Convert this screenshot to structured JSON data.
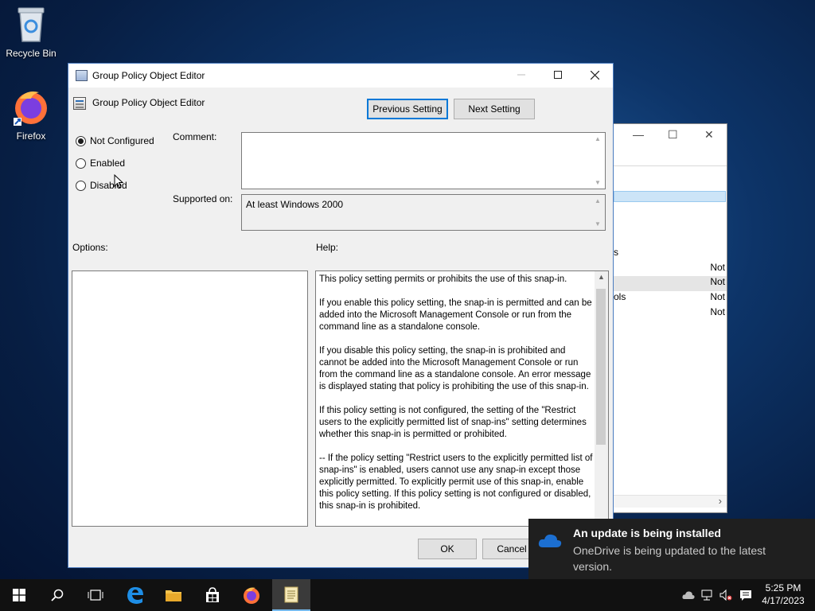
{
  "desktop": {
    "icons": [
      {
        "label": "Recycle Bin"
      },
      {
        "label": "Firefox"
      }
    ]
  },
  "background_window": {
    "title_controls": [
      "—",
      "☐",
      "✕"
    ],
    "row_fragments": [
      {
        "left": "s",
        "right": ""
      },
      {
        "left": "",
        "right": "Not"
      },
      {
        "left": "",
        "right": "Not"
      },
      {
        "left": "ols",
        "right": "Not"
      },
      {
        "left": "",
        "right": "Not"
      }
    ],
    "scroll_right_glyph": "›"
  },
  "dialog": {
    "window_title": "Group Policy Object Editor",
    "header_title": "Group Policy Object Editor",
    "previous_button": "Previous Setting",
    "next_button": "Next Setting",
    "radio_options": [
      {
        "label": "Not Configured",
        "selected": true
      },
      {
        "label": "Enabled",
        "selected": false
      },
      {
        "label": "Disabled",
        "selected": false
      }
    ],
    "comment_label": "Comment:",
    "comment_value": "",
    "supported_on_label": "Supported on:",
    "supported_on_value": "At least Windows 2000",
    "options_label": "Options:",
    "help_label": "Help:",
    "help_paragraphs": [
      "This policy setting permits or prohibits the use of this snap-in.",
      "If you enable this policy setting, the snap-in is permitted and can be added into the Microsoft Management Console or run from the command line as a standalone console.",
      "If you disable this policy setting, the snap-in is prohibited and cannot be added into the Microsoft Management Console or run from the command line as a standalone console. An error message is displayed stating that policy is prohibiting the use of this snap-in.",
      "If this policy setting is not configured, the setting of the \"Restrict users to the explicitly permitted list of snap-ins\" setting determines whether this snap-in is permitted or prohibited.",
      "--  If the policy setting \"Restrict users to the explicitly permitted list of snap-ins\" is enabled, users cannot use any snap-in except those explicitly permitted. To explicitly permit use of this snap-in, enable this policy setting. If this policy setting is not configured or disabled, this snap-in is prohibited."
    ],
    "ok_button": "OK",
    "cancel_button": "Cancel"
  },
  "toast": {
    "title": "An update is being installed",
    "body": "OneDrive is being updated to the latest version."
  },
  "taskbar": {
    "items": [
      "start-icon",
      "search-icon",
      "task-view-icon",
      "edge-icon",
      "file-explorer-icon",
      "store-icon",
      "firefox-icon",
      "notepad-icon"
    ],
    "clock_time": "5:25 PM",
    "clock_date": "4/17/2023"
  },
  "colors": {
    "accent": "#0078d7",
    "taskbar": "#111111",
    "toast_bg": "#1f1f1f"
  }
}
